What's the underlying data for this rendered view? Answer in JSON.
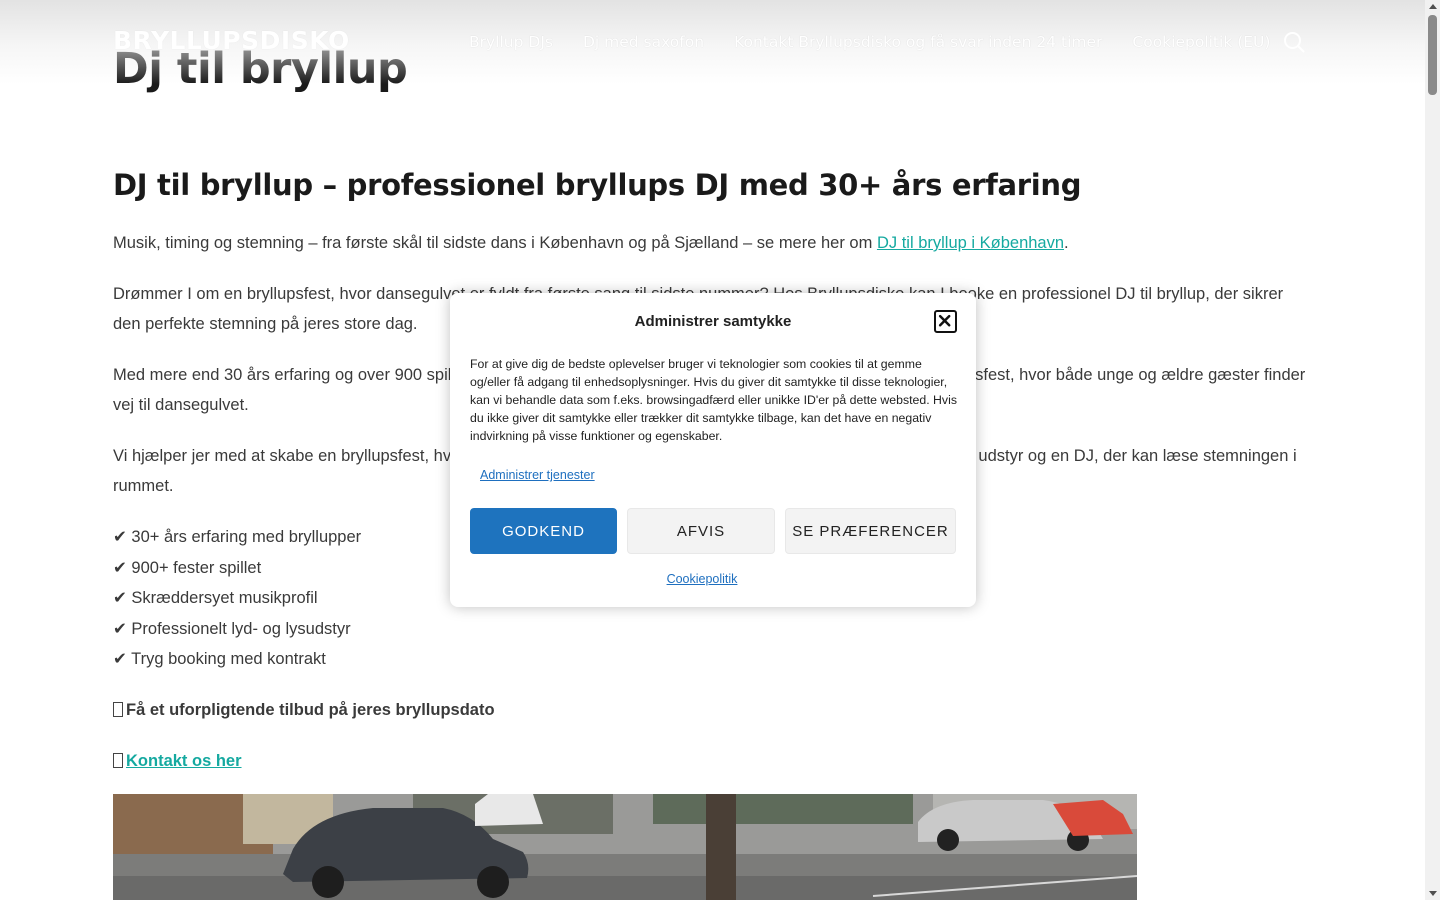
{
  "header": {
    "logo": "BRYLLUPSDISKO",
    "nav": [
      {
        "label": "Bryllup DJs"
      },
      {
        "label": "Dj med saxofon"
      },
      {
        "label": "Kontakt Bryllupsdisko og få svar inden 24 timer"
      },
      {
        "label": "Cookiepolitik (EU)"
      }
    ],
    "search_icon": "search-icon"
  },
  "page": {
    "title": "Dj til bryllup",
    "heading": "DJ til bryllup – professionel bryllups DJ med 30+ års erfaring",
    "intro_text": "Musik, timing og stemning – fra første skål til sidste dans i København og på Sjælland – se mere her om ",
    "intro_link": "DJ til bryllup i København",
    "intro_end": ".",
    "para1": "Drømmer I om en bryllupsfest, hvor dansegulvet er fyldt fra første sang til sidste nummer? Hos Bryllupsdisko kan I booke en professionel DJ til bryllup, der sikrer den perfekte stemning på jeres store dag.",
    "para2": "Med mere end 30 års erfaring og over 900 spillede fester ved vi, hvad der skal til for at skabe en uforglemmelig bryllupsfest, hvor både unge og ældre gæster finder vej til dansegulvet.",
    "para3": "Vi hjælper jer med at skabe en bryllupsfest, hvor musikken passer til jeres gæster og jeres ønsker – med professionelt udstyr og en DJ, der kan læse stemningen i rummet.",
    "checks": [
      {
        "text": "✔ 30+ års erfaring med bryllupper"
      },
      {
        "text": "✔ 900+ fester spillet"
      },
      {
        "text": "✔ Skræddersyet musikprofil"
      },
      {
        "text": "✔ Professionelt lyd- og lysudstyr"
      },
      {
        "text": "✔ Tryg booking med kontrakt"
      }
    ],
    "offer": "Få et uforpligtende tilbud på jeres bryllupsdato",
    "contact_link": "Kontakt os her"
  },
  "consent": {
    "title": "Administrer samtykke",
    "body": "For at give dig de bedste oplevelser bruger vi teknologier som cookies til at gemme og/eller få adgang til enhedsoplysninger. Hvis du giver dit samtykke til disse teknologier, kan vi behandle data som f.eks. browsingadfærd eller unikke ID'er på dette websted. Hvis du ikke giver dit samtykke eller trækker dit samtykke tilbage, kan det have en negativ indvirkning på visse funktioner og egenskaber.",
    "manage_link": "Administrer tjenester",
    "accept": "GODKEND",
    "deny": "AFVIS",
    "prefs": "SE PRÆFERENCER",
    "policy_link": "Cookiepolitik",
    "accent": "#1e73be"
  },
  "colors": {
    "link": "#15a9a0",
    "heading": "#1a1a1a"
  }
}
